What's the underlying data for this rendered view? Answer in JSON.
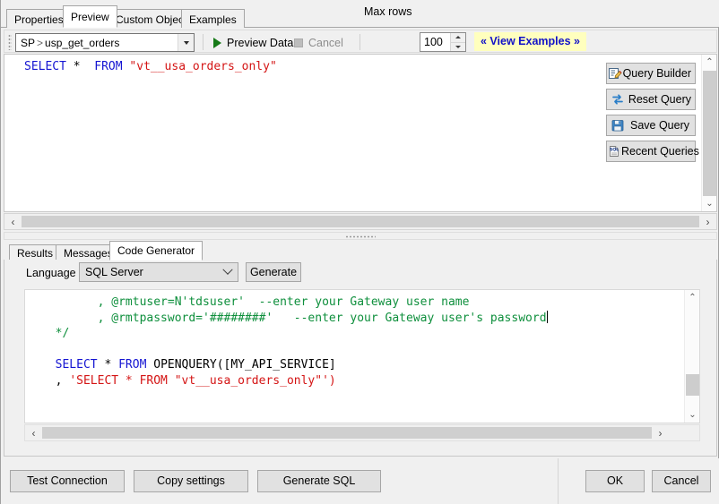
{
  "tabs": {
    "items": [
      {
        "label": "Properties",
        "active": false
      },
      {
        "label": "Preview",
        "active": true
      },
      {
        "label": "Custom Objects",
        "active": false
      },
      {
        "label": "Examples",
        "active": false
      }
    ]
  },
  "toolbar": {
    "object_combo": {
      "prefix": "SP",
      "separator": ">",
      "value": "usp_get_orders"
    },
    "preview_data_label": "Preview Data",
    "cancel_label": "Cancel",
    "max_rows_label": "Max rows",
    "max_rows_value": "100",
    "view_examples_label": "« View Examples »",
    "play_icon": "play-icon",
    "stop_icon": "stop-icon"
  },
  "editor": {
    "line": {
      "kw_select": "SELECT",
      "star": "*",
      "kw_from": "FROM",
      "string": "\"vt__usa_orders_only\""
    }
  },
  "side_buttons": [
    {
      "label": "Query Builder",
      "icon": "edit-form-icon",
      "name": "query-builder-button"
    },
    {
      "label": "Reset Query",
      "icon": "refresh-icon",
      "name": "reset-query-button"
    },
    {
      "label": "Save Query",
      "icon": "floppy-disk-icon",
      "name": "save-query-button"
    },
    {
      "label": "Recent Queries",
      "icon": "sql-document-icon",
      "name": "recent-queries-button"
    }
  ],
  "bottom_tabs": {
    "items": [
      {
        "label": "Results",
        "active": false
      },
      {
        "label": "Messages",
        "active": false
      },
      {
        "label": "Code Generator",
        "active": true
      }
    ]
  },
  "code_generator": {
    "language_label": "Language",
    "language_value": "SQL Server",
    "generate_label": "Generate",
    "code": {
      "line1_comment": "        , @rmtuser=N'tdsuser'  --enter your Gateway user name",
      "line2_comment": "        , @rmtpassword='########'   --enter your Gateway user's password",
      "line3_comment": "*/",
      "line5": {
        "kw_select": "SELECT",
        "star": "*",
        "kw_from": "FROM",
        "func": "OPENQUERY([MY_API_SERVICE]"
      },
      "line6": {
        "comma": ",",
        "string": "'SELECT * FROM \"vt__usa_orders_only\"')"
      }
    }
  },
  "dialog_buttons": {
    "test_connection": "Test Connection",
    "copy_settings": "Copy settings",
    "generate_sql": "Generate SQL",
    "ok": "OK",
    "cancel": "Cancel"
  },
  "scrollbars": {
    "left_arrow": "‹",
    "right_arrow": "›",
    "up_arrow": "⌃",
    "down_arrow": "⌄"
  },
  "colors": {
    "keyword": "#1414d2",
    "string": "#d41414",
    "comment": "#0e8f3c",
    "accent_link": "#1212c8",
    "highlight_bg": "#ffffbe",
    "play_green": "#167a17"
  }
}
